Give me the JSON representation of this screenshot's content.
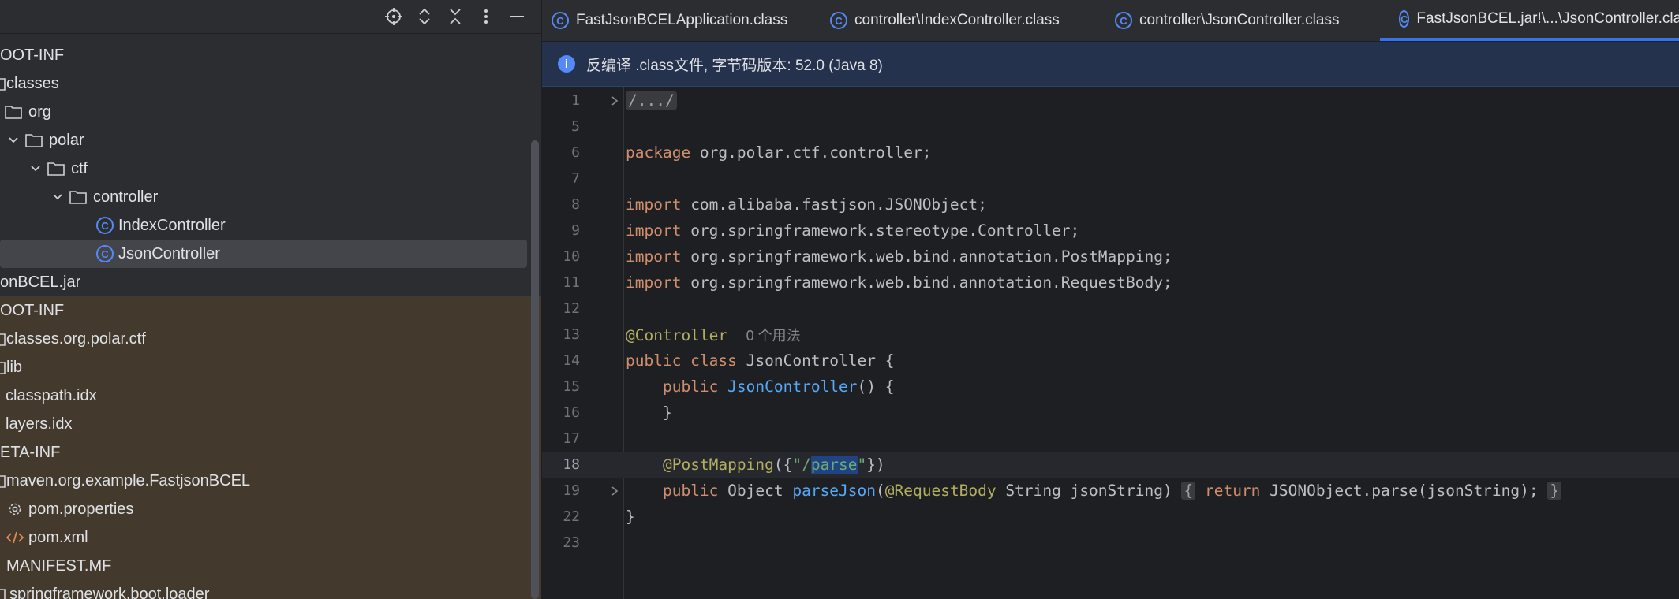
{
  "toolbar": {
    "icons": [
      "crosshair-icon",
      "expand-all-icon",
      "collapse-all-icon",
      "more-options-icon",
      "minimize-icon"
    ]
  },
  "tree": [
    {
      "label": "OOT-INF"
    },
    {
      "label": "classes"
    },
    {
      "label": "org"
    },
    {
      "label": "polar"
    },
    {
      "label": "ctf"
    },
    {
      "label": "controller"
    },
    {
      "label": "IndexController"
    },
    {
      "label": "JsonController"
    },
    {
      "label": "onBCEL.jar"
    },
    {
      "label": "OOT-INF"
    },
    {
      "label": "classes.org.polar.ctf"
    },
    {
      "label": "lib"
    },
    {
      "label": "classpath.idx"
    },
    {
      "label": "layers.idx"
    },
    {
      "label": "ETA-INF"
    },
    {
      "label": "maven.org.example.FastjsonBCEL"
    },
    {
      "label": "pom.properties"
    },
    {
      "label": "pom.xml"
    },
    {
      "label": "MANIFEST.MF"
    },
    {
      "label": "springframework.boot.loader"
    }
  ],
  "tabs": [
    {
      "label": "FastJsonBCELApplication.class"
    },
    {
      "label": "controller\\IndexController.class"
    },
    {
      "label": "controller\\JsonController.class"
    },
    {
      "label": "FastJsonBCEL.jar!\\...\\JsonController.class"
    }
  ],
  "banner": {
    "text": "反编译 .class文件, 字节码版本: 52.0 (Java 8)"
  },
  "code": {
    "line_numbers": [
      "1",
      "5",
      "6",
      "7",
      "8",
      "9",
      "10",
      "11",
      "12",
      "13",
      "14",
      "15",
      "16",
      "17",
      "18",
      "19",
      "22",
      "23"
    ],
    "l1": "/.../",
    "l6_kw": "package",
    "l6_rest": " org.polar.ctf.controller;",
    "l8_kw": "import",
    "l8_rest": " com.alibaba.fastjson.JSONObject;",
    "l9_kw": "import",
    "l9_rest": " org.springframework.stereotype.Controller;",
    "l10_kw": "import",
    "l10_rest": " org.springframework.web.bind.annotation.PostMapping;",
    "l11_kw": "import",
    "l11_rest": " org.springframework.web.bind.annotation.RequestBody;",
    "l13_ann": "@Controller",
    "l13_hint": "0 个用法",
    "l14_kw": "public class",
    "l14_rest": " JsonController {",
    "l15_kw": "public",
    "l15_fn": "JsonController",
    "l15_rest": "() {",
    "l16": "}",
    "l18_ann": "@PostMapping",
    "l18_p1": "({",
    "l18_s1": "\"/",
    "l18_sel": "parse",
    "l18_s2": "\"",
    "l18_p2": "})",
    "l19_kw1": "public",
    "l19_t1": " Object ",
    "l19_fn": "parseJson",
    "l19_p1": "(",
    "l19_ann": "@RequestBody",
    "l19_t2": " String jsonString)",
    "l19_fold1": "{",
    "l19_kw2": "return",
    "l19_t3": " JSONObject.parse(jsonString);",
    "l19_fold2": "}",
    "l22": "}"
  }
}
